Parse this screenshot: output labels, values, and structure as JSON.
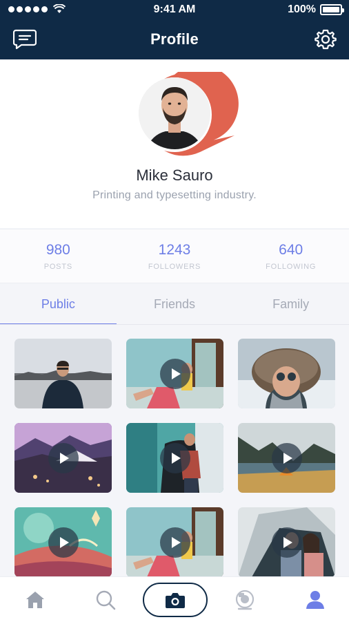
{
  "status_bar": {
    "time": "9:41 AM",
    "battery": "100%"
  },
  "header": {
    "title": "Profile",
    "left_icon": "message-icon",
    "right_icon": "gear-icon"
  },
  "profile": {
    "name": "Mike Sauro",
    "bio": "Printing and typesetting industry."
  },
  "stats": [
    {
      "value": "980",
      "label": "POSTS"
    },
    {
      "value": "1243",
      "label": "FOLLOWERS"
    },
    {
      "value": "640",
      "label": "FOLLOWING"
    }
  ],
  "tabs": [
    {
      "label": "Public",
      "active": true
    },
    {
      "label": "Friends",
      "active": false
    },
    {
      "label": "Family",
      "active": false
    }
  ],
  "media_grid": [
    {
      "kind": "photo",
      "subject": "man-at-lake"
    },
    {
      "kind": "video",
      "subject": "woman-in-chair-window"
    },
    {
      "kind": "photo",
      "subject": "woman-in-fur-hood"
    },
    {
      "kind": "video",
      "subject": "purple-mountain-town"
    },
    {
      "kind": "video",
      "subject": "man-on-chair-by-window"
    },
    {
      "kind": "video",
      "subject": "mountain-lake-tent"
    },
    {
      "kind": "video",
      "subject": "sci-fi-landscape"
    },
    {
      "kind": "video",
      "subject": "woman-in-chair-window"
    },
    {
      "kind": "video",
      "subject": "couple-in-tent"
    }
  ],
  "bottom_nav": [
    {
      "icon": "home-icon",
      "active": false
    },
    {
      "icon": "search-icon",
      "active": false
    },
    {
      "icon": "camera-icon",
      "active": false
    },
    {
      "icon": "webcam-icon",
      "active": false
    },
    {
      "icon": "user-icon",
      "active": true
    }
  ],
  "colors": {
    "header": "#0f2a46",
    "accent": "#6d7ee6",
    "avatar_ring": "#e0634f"
  }
}
